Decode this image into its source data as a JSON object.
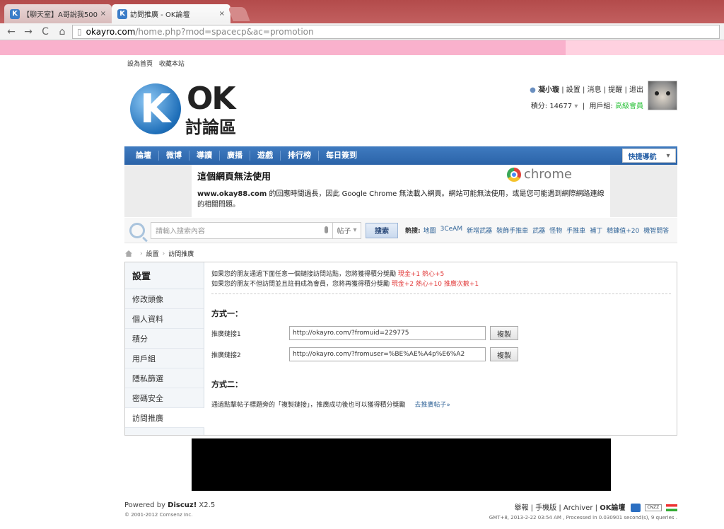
{
  "browser": {
    "tabs": [
      {
        "title": "【聊天室】A哥說我500了"
      },
      {
        "title": "訪問推廣 - OK論壇"
      }
    ],
    "close_glyph": "×",
    "url_host": "okayro.com",
    "url_path": "/home.php?mod=spacecp&ac=promotion"
  },
  "topline": {
    "set_home": "設為首頁",
    "bookmark": "收藏本站"
  },
  "logo": {
    "k": "K",
    "ok": "OK",
    "forum": "討論區"
  },
  "user": {
    "name": "凝小璇",
    "links": [
      "設置",
      "消息",
      "提醒",
      "退出"
    ],
    "credits_label": "積分: 14677",
    "group_label": "用戶組:",
    "group": "高級會員"
  },
  "nav": {
    "items": [
      "論壇",
      "微博",
      "導讀",
      "廣播",
      "遊戲",
      "排行榜",
      "每日簽到"
    ],
    "quick": "快捷導航"
  },
  "error": {
    "title": "這個網頁無法使用",
    "brand": "chrome",
    "domain": "www.okay88.com",
    "message": " 的回應時間過長，因此 Google Chrome 無法載入網頁。網站可能無法使用，或是您可能遇到網際網路連線的相關問題。"
  },
  "search": {
    "placeholder": "請輸入搜索內容",
    "type": "帖子",
    "button": "搜索",
    "hot_label": "熱搜:",
    "hot": [
      "地圖",
      "3CeAM",
      "新增武器",
      "裝飾手推車",
      "武器",
      "怪物",
      "手推車",
      "補丁",
      "精鍊值+20",
      "機智問答"
    ]
  },
  "breadcrumb": [
    "設置",
    "訪問推廣"
  ],
  "sidebar": {
    "title": "設置",
    "items": [
      "修改頭像",
      "個人資料",
      "積分",
      "用戶組",
      "隱私篩選",
      "密碼安全",
      "訪問推廣"
    ]
  },
  "main": {
    "note1": "如果您的朋友通過下面任意一個鏈接訪問站點，您將獲得積分獎勵",
    "note1_reward": "現金+1 熱心+5",
    "note2": "如果您的朋友不但訪問並且註冊成為會員，您將再獲得積分獎勵",
    "note2_reward": "現金+2 熱心+10 推廣次數+1",
    "method1": "方式一：",
    "link1_label": "推廣鏈接1",
    "link1_value": "http://okayro.com/?fromuid=229775",
    "link2_label": "推廣鏈接2",
    "link2_value": "http://okayro.com/?fromuser=%BE%AE%A4p%E6%A2",
    "copy": "複製",
    "method2": "方式二：",
    "method2_text": "通過點擊帖子標題旁的「複製鏈接」，推廣成功後也可以獲得積分獎勵",
    "method2_link": "去推廣帖子»"
  },
  "footer": {
    "powered": "Powered by ",
    "discuz": "Discuz!",
    "version": " X2.5",
    "copyright": "© 2001-2012 Comsenz Inc.",
    "links": [
      "舉報",
      "手機版",
      "Archiver"
    ],
    "site": "OK論壇",
    "cnzz": "CNZZ",
    "gmt": "GMT+8, 2013-2-22 03:54 AM , Processed in 0.030901 second(s), 9 queries ."
  }
}
